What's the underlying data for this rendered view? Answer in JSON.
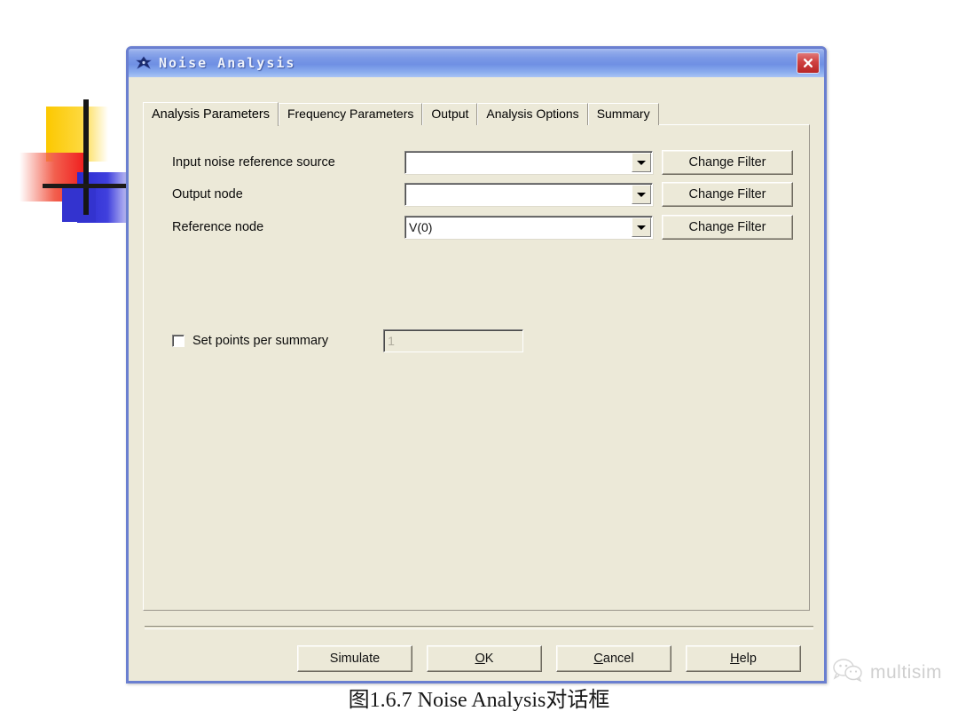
{
  "window": {
    "title": "Noise Analysis",
    "icon": "analysis-diamond-icon",
    "close_label": "×",
    "titlebar_color": "#7b99e6",
    "face_color": "#ece9d8",
    "border_color": "#6a7fd0",
    "close_color": "#cf4141"
  },
  "tabs": [
    {
      "label": "Analysis Parameters",
      "active": true
    },
    {
      "label": "Frequency Parameters",
      "active": false
    },
    {
      "label": "Output",
      "active": false
    },
    {
      "label": "Analysis Options",
      "active": false
    },
    {
      "label": "Summary",
      "active": false
    }
  ],
  "form": {
    "rows": [
      {
        "label": "Input noise reference source",
        "value": "",
        "button": "Change Filter"
      },
      {
        "label": "Output node",
        "value": "",
        "button": "Change Filter"
      },
      {
        "label": "Reference node",
        "value": "V(0)",
        "button": "Change Filter"
      }
    ],
    "points_per_summary": {
      "checkbox_label": "Set points per summary",
      "checked": false,
      "value": "1",
      "enabled": false
    }
  },
  "footer": {
    "buttons": [
      {
        "label": "Simulate",
        "accel": ""
      },
      {
        "label": "OK",
        "accel": "O"
      },
      {
        "label": "Cancel",
        "accel": "C"
      },
      {
        "label": "Help",
        "accel": "H"
      }
    ]
  },
  "caption": "图1.6.7 Noise Analysis对话框",
  "watermark": {
    "text": "multisim",
    "icon": "wechat-logo-icon"
  },
  "decoration": {
    "name": "mondrian-graphic",
    "colors": {
      "yellow": "#fcc800",
      "red": "#f02020",
      "blue": "#2a2ad0",
      "black": "#161616"
    }
  }
}
